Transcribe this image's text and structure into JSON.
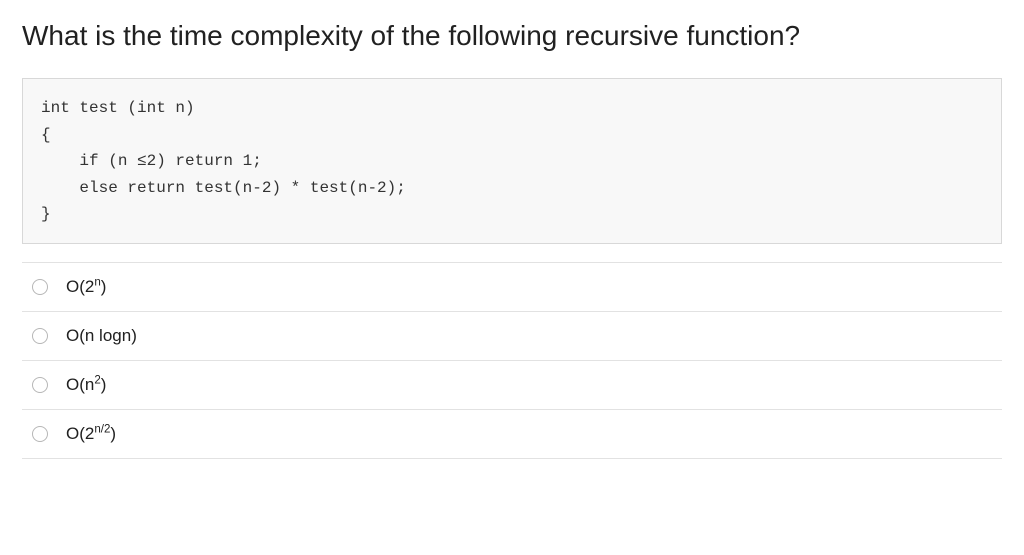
{
  "question": {
    "heading": "What is the time complexity of the following recursive function?",
    "code": "int test (int n)\n{\n    if (n ≤2) return 1;\n    else return test(n-2) * test(n-2);\n}"
  },
  "options": [
    {
      "label_html": "O(2<sup>n</sup>)"
    },
    {
      "label_html": "O(n logn)"
    },
    {
      "label_html": "O(n<sup>2</sup>)"
    },
    {
      "label_html": "O(2<sup>n/2</sup>)"
    }
  ]
}
